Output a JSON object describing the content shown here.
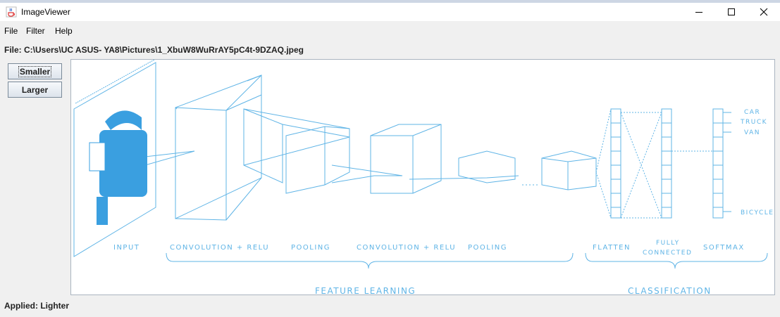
{
  "window": {
    "title": "ImageViewer",
    "icon": "java-cup-icon"
  },
  "menu": [
    "File",
    "Filter",
    "Help"
  ],
  "file_path": "File: C:\\Users\\UC ASUS- YA8\\Pictures\\1_XbuW8WuRrAY5pC4t-9DZAQ.jpeg",
  "buttons": {
    "smaller": "Smaller",
    "larger": "Larger"
  },
  "status": "Applied: Lighter",
  "diagram": {
    "stage_labels": {
      "input": "INPUT",
      "conv1": "CONVOLUTION + RELU",
      "pool1": "POOLING",
      "conv2": "CONVOLUTION + RELU",
      "pool2": "POOLING",
      "flatten": "FLATTEN",
      "fully_connected_1": "FULLY",
      "fully_connected_2": "CONNECTED",
      "softmax": "SOFTMAX"
    },
    "group_labels": {
      "feature_learning": "FEATURE LEARNING",
      "classification": "CLASSIFICATION"
    },
    "classes": {
      "car": "CAR",
      "truck": "TRUCK",
      "van": "VAN",
      "bicycle": "BICYCLE"
    },
    "line_color": "#5fb4e6",
    "car_color": "#3a9fe0"
  }
}
